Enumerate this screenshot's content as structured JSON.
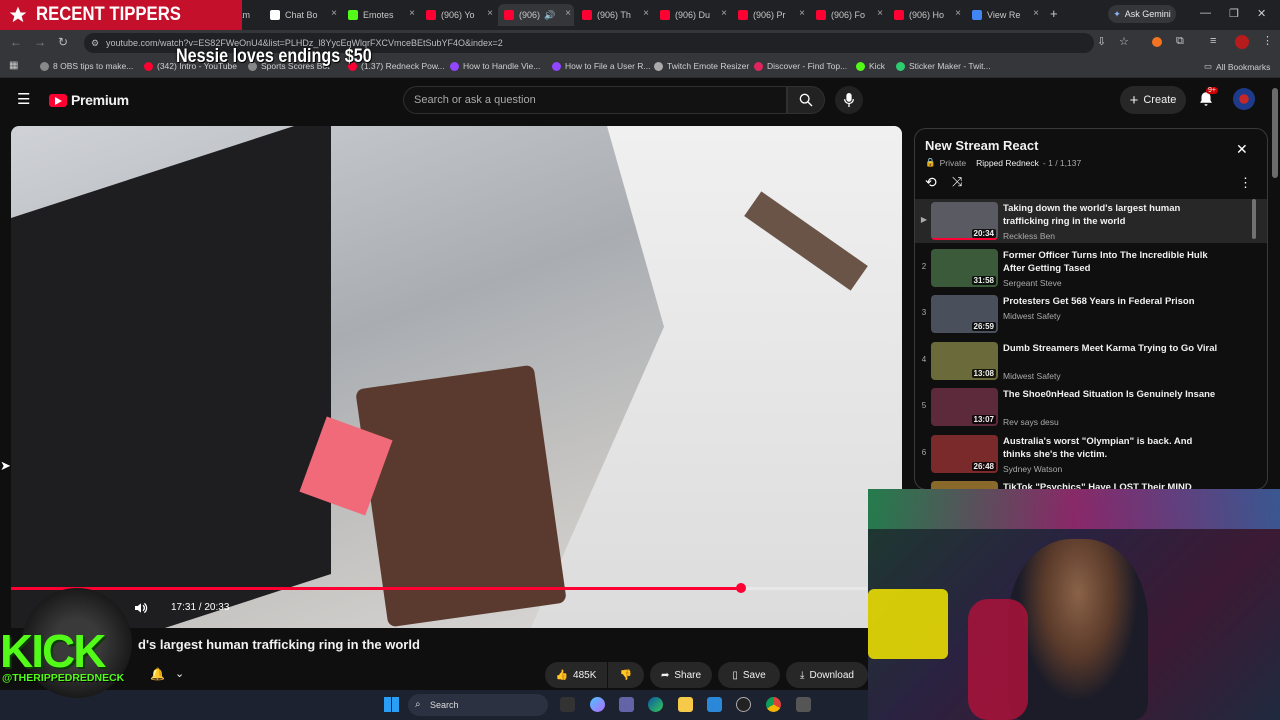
{
  "overlay": {
    "tippers_label": "RECENT TIPPERS",
    "ticker": "Nessie loves endings $50",
    "kick_label": "KICK",
    "kick_handle": "@THERIPPEDREDNECK"
  },
  "browser": {
    "tabs": [
      {
        "label": "Stream",
        "color": "#9146ff"
      },
      {
        "label": "Chat Bo",
        "color": "#ffffff"
      },
      {
        "label": "Emotes",
        "color": "#53fc18"
      },
      {
        "label": "(906) Yo",
        "color": "#ff0033"
      },
      {
        "label": "(906)",
        "color": "#ff0033"
      },
      {
        "label": "(906) Th",
        "color": "#ff0033"
      },
      {
        "label": "(906) Du",
        "color": "#ff0033"
      },
      {
        "label": "(906) Pr",
        "color": "#ff0033"
      },
      {
        "label": "(906) Fo",
        "color": "#ff0033"
      },
      {
        "label": "(906) Ho",
        "color": "#ff0033"
      },
      {
        "label": "View Re",
        "color": "#4285f4"
      }
    ],
    "ask_gemini": "Ask Gemini",
    "url": "youtube.com/watch?v=ES82FWeOnU4&list=PLHDz_l8YycEqWlqrFXCVmceBEtSubYF4O&index=2",
    "bookmarks": [
      {
        "label": "8 OBS tips to make...",
        "color": "#888888"
      },
      {
        "label": "(342) Intro - YouTube",
        "color": "#ff0033"
      },
      {
        "label": "Sports Scores Bot",
        "color": "#888888"
      },
      {
        "label": "(1.37) Redneck Pow...",
        "color": "#ff0033"
      },
      {
        "label": "How to Handle Vie...",
        "color": "#9146ff"
      },
      {
        "label": "How to File a User R...",
        "color": "#9146ff"
      },
      {
        "label": "Twitch Emote Resizer",
        "color": "#aaaaaa"
      },
      {
        "label": "Discover - Find Top...",
        "color": "#e0245e"
      },
      {
        "label": "Kick",
        "color": "#53fc18"
      },
      {
        "label": "Sticker Maker - Twit...",
        "color": "#2ecc71"
      }
    ],
    "all_bookmarks": "All Bookmarks"
  },
  "youtube": {
    "logo_label": "Premium",
    "search_placeholder": "Search or ask a question",
    "create_label": "Create",
    "notif_count": "9+"
  },
  "player": {
    "time": "17:31 / 20:33",
    "progress": 0.853
  },
  "video": {
    "title": "d's largest human trafficking ring in the world",
    "likes": "485K",
    "share": "Share",
    "save": "Save",
    "download": "Download"
  },
  "playlist": {
    "title": "New Stream React",
    "privacy": "Private",
    "owner": "Ripped Redneck",
    "position": "- 1 / 1,137",
    "items": [
      {
        "index": "▶",
        "title": "Taking down the world's largest human trafficking ring in the world",
        "channel": "Reckless Ben",
        "duration": "20:34",
        "thumb": "#5a5a62"
      },
      {
        "index": "2",
        "title": "Former Officer Turns Into The Incredible Hulk After Getting Tased",
        "channel": "Sergeant Steve",
        "duration": "31:58",
        "thumb": "#3b5a3a"
      },
      {
        "index": "3",
        "title": "Protesters Get 568 Years in Federal Prison",
        "channel": "Midwest Safety",
        "duration": "26:59",
        "thumb": "#4a4f5c"
      },
      {
        "index": "4",
        "title": "Dumb Streamers Meet Karma Trying to Go Viral",
        "channel": "Midwest Safety",
        "duration": "13:08",
        "thumb": "#6b6a3a"
      },
      {
        "index": "5",
        "title": "The Shoe0nHead Situation Is Genuinely Insane",
        "channel": "Rev says desu",
        "duration": "13:07",
        "thumb": "#5c2a3a"
      },
      {
        "index": "6",
        "title": "Australia's worst \"Olympian\" is back. And thinks she's the victim.",
        "channel": "Sydney Watson",
        "duration": "26:48",
        "thumb": "#7a2a2a"
      },
      {
        "index": "7",
        "title": "TikTok \"Psychics\" Have LOST Their MIND",
        "channel": "",
        "duration": "",
        "thumb": "#8a6a2a"
      }
    ]
  },
  "taskbar": {
    "search_label": "Search"
  }
}
